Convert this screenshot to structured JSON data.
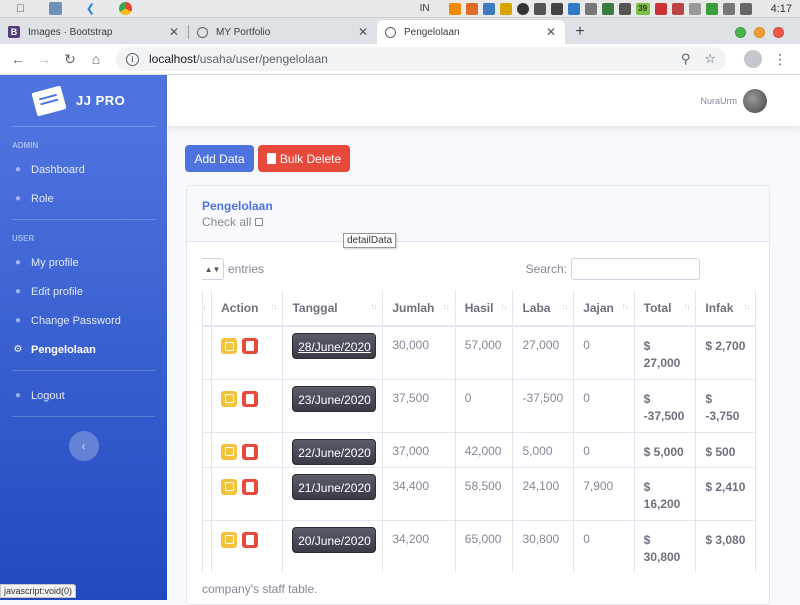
{
  "os": {
    "keyboard_indicator": "IN",
    "battery_badge": "39",
    "time": "4:17"
  },
  "browser": {
    "tabs": [
      {
        "label": "Images · Bootstrap",
        "favicon": "bootstrap-icon",
        "active": false
      },
      {
        "label": "MY Portfolio",
        "favicon": "globe-icon",
        "active": false
      },
      {
        "label": "Pengelolaan",
        "favicon": "globe-icon",
        "active": true
      }
    ],
    "url_host": "localhost",
    "url_path": "/usaha/user/pengelolaan",
    "status_url": "javascript:void(0)"
  },
  "sidebar": {
    "brand": "JJ PRO",
    "heading_admin": "ADMIN",
    "heading_user": "USER",
    "items": {
      "dashboard": "Dashboard",
      "role": "Role",
      "my_profile": "My profile",
      "edit_profile": "Edit profile",
      "change_password": "Change Password",
      "pengelolaan": "Pengelolaan",
      "logout": "Logout"
    }
  },
  "topbar": {
    "user_name": "NuraUrm"
  },
  "toolbar": {
    "add_label": "Add Data",
    "bulk_label": "Bulk Delete"
  },
  "card": {
    "title": "Pengelolaan",
    "check_all": "Check all",
    "entries_label": "entries",
    "search_label": "Search:"
  },
  "table": {
    "headers": [
      "Action",
      "Tanggal",
      "Jumlah",
      "Hasil",
      "Laba",
      "Jajan",
      "Total",
      "Infak"
    ],
    "rows": [
      {
        "tanggal": "28/June/2020",
        "jumlah": "30,000",
        "hasil": "57,000",
        "laba": "27,000",
        "jajan": "0",
        "total_1": "$",
        "total_2": "27,000",
        "infak": "$ 2,700"
      },
      {
        "tanggal": "23/June/2020",
        "jumlah": "37,500",
        "hasil": "0",
        "laba": "-37,500",
        "jajan": "0",
        "total_1": "$",
        "total_2": "-37,500",
        "infak": "$",
        "infak_2": "-3,750"
      },
      {
        "tanggal": "22/June/2020",
        "jumlah": "37,000",
        "hasil": "42,000",
        "laba": "5,000",
        "jajan": "0",
        "total_1": "$ 5,000",
        "total_2": "",
        "infak": "$ 500"
      },
      {
        "tanggal": "21/June/2020",
        "jumlah": "34,400",
        "hasil": "58,500",
        "laba": "24,100",
        "jajan": "7,900",
        "total_1": "$",
        "total_2": "16,200",
        "infak": "$ 2,410"
      },
      {
        "tanggal": "20/June/2020",
        "jumlah": "34,200",
        "hasil": "65,000",
        "laba": "30,800",
        "jajan": "0",
        "total_1": "$",
        "total_2": "30,800",
        "infak": "$ 3,080"
      }
    ],
    "tooltip": "detailData",
    "caption": "company's staff table."
  },
  "colors": {
    "primary": "#4e73df",
    "danger": "#e74a3b",
    "warning": "#f6c23e",
    "dark": "#3a3b45"
  }
}
